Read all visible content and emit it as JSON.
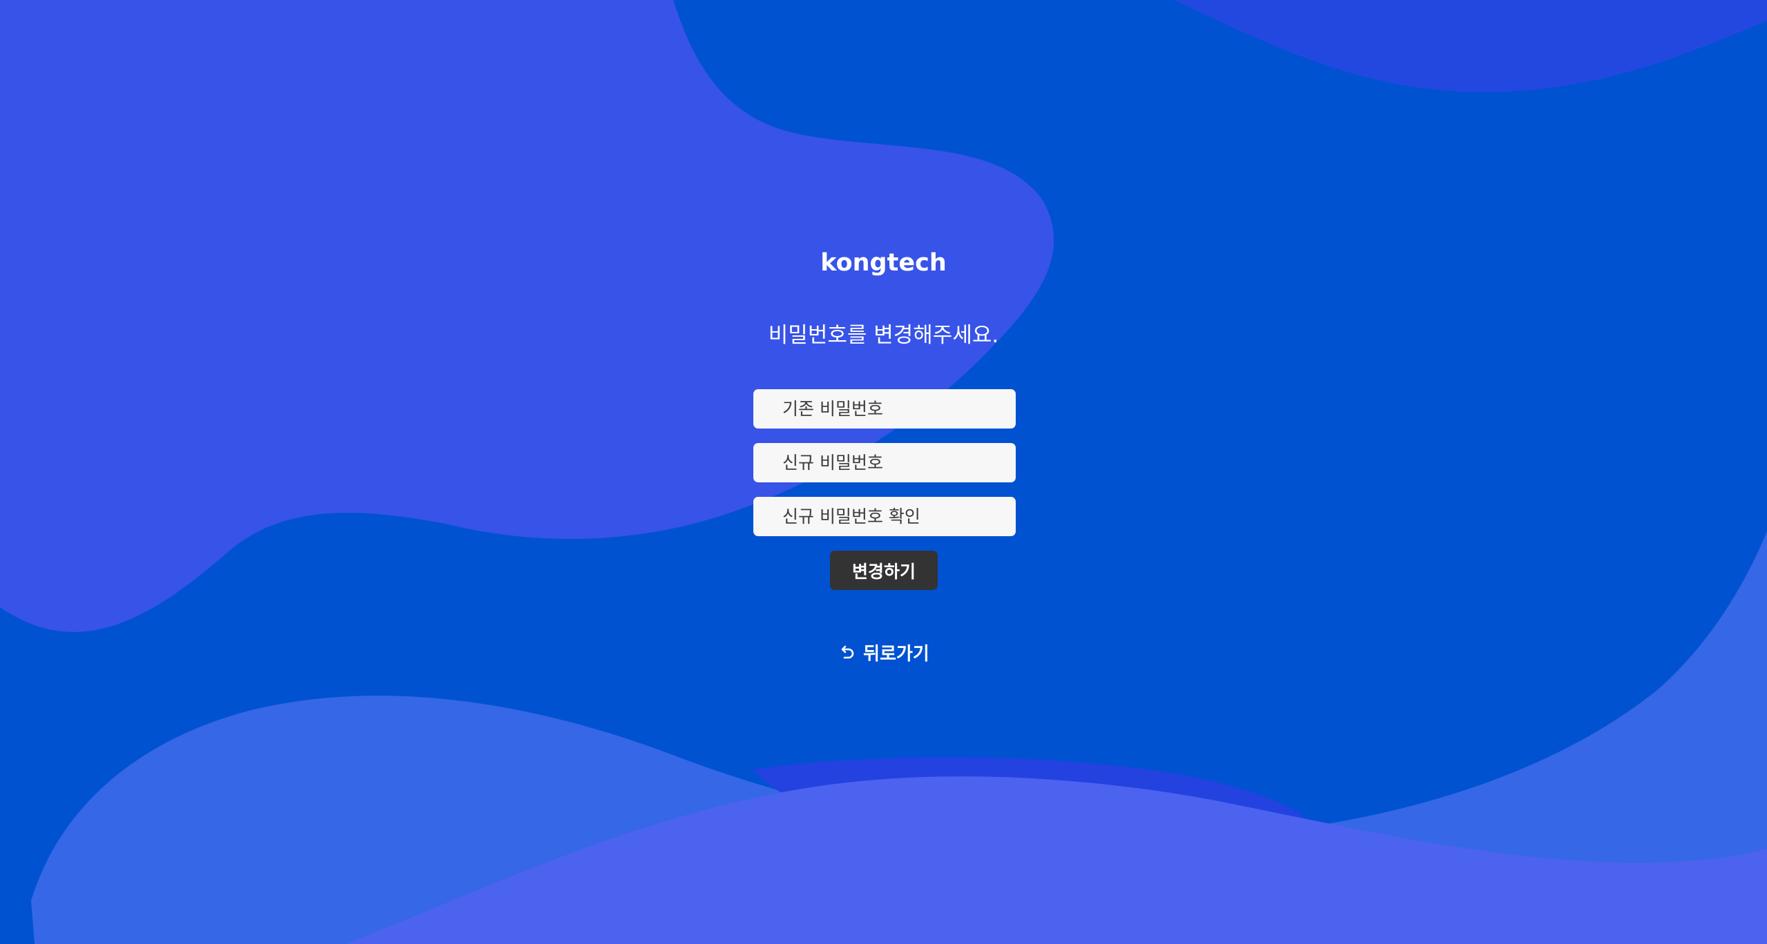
{
  "brand": {
    "logo_text": "kongtech"
  },
  "form": {
    "heading": "비밀번호를 변경해주세요.",
    "current_password": {
      "placeholder": "기존 비밀번호",
      "value": ""
    },
    "new_password": {
      "placeholder": "신규 비밀번호",
      "value": ""
    },
    "confirm_password": {
      "placeholder": "신규 비밀번호 확인",
      "value": ""
    },
    "submit_label": "변경하기"
  },
  "nav": {
    "back_label": "뒤로가기",
    "back_icon": "undo-arrow-icon"
  },
  "colors": {
    "background": "#0052d1",
    "wave_light": "#3753e8",
    "wave_bottom": "#4b63ef",
    "button": "#333333",
    "input_bg": "#f7f7f7",
    "text_light": "#ffffff"
  }
}
